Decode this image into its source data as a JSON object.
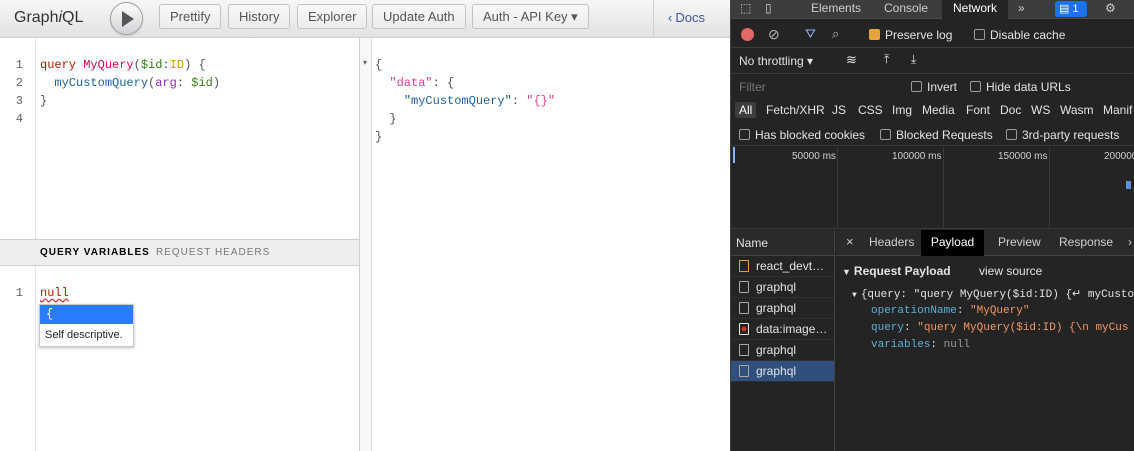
{
  "graphiql": {
    "logo_pre": "Graph",
    "logo_i": "i",
    "logo_post": "QL",
    "toolbar": {
      "prettify": "Prettify",
      "history": "History",
      "explorer": "Explorer",
      "update_auth": "Update Auth",
      "auth_select": "Auth - API Key ▾"
    },
    "docs_label": "Docs",
    "query_lines": [
      "1",
      "2",
      "3",
      "4"
    ],
    "query": {
      "l1_kw": "query",
      "l1_name": "MyQuery",
      "l1_open": "(",
      "l1_var": "$id",
      "l1_colon": ":",
      "l1_type": "ID",
      "l1_close": ") {",
      "l2_field": "myCustomQuery",
      "l2_open": "(",
      "l2_arg": "arg",
      "l2_colon": ": ",
      "l2_var": "$id",
      "l2_close": ")",
      "l3": "}"
    },
    "var_tabs": {
      "variables": "QUERY VARIABLES",
      "headers": "REQUEST HEADERS"
    },
    "var_line": "1",
    "var_value": "null",
    "hint": {
      "item": "{",
      "description": "Self descriptive."
    },
    "result": {
      "open": "{",
      "data_key": "\"data\"",
      "colon1": ": {",
      "field_key": "\"myCustomQuery\"",
      "colon2": ": ",
      "field_val": "\"{}\"",
      "inner_close": "}",
      "close": "}"
    }
  },
  "devtools": {
    "tabs": {
      "elements": "Elements",
      "console": "Console",
      "network": "Network",
      "more": "»",
      "badge": "1"
    },
    "toolbar1": {
      "preserve_log": "Preserve log",
      "disable_cache": "Disable cache"
    },
    "toolbar2": {
      "throttling": "No throttling",
      "dropdown": "▾"
    },
    "filter": {
      "placeholder": "Filter",
      "invert": "Invert",
      "hide_data_urls": "Hide data URLs"
    },
    "type_filters": [
      "All",
      "Fetch/XHR",
      "JS",
      "CSS",
      "Img",
      "Media",
      "Font",
      "Doc",
      "WS",
      "Wasm",
      "Manif"
    ],
    "block_filters": {
      "blocked_cookies": "Has blocked cookies",
      "blocked_requests": "Blocked Requests",
      "third_party": "3rd-party requests"
    },
    "timeline_ticks": [
      "50000 ms",
      "100000 ms",
      "150000 ms",
      "200000"
    ],
    "name_header": "Name",
    "requests": [
      "react_devt…",
      "graphql",
      "graphql",
      "data:image…",
      "graphql",
      "graphql"
    ],
    "selected_request_index": 5,
    "detail_tabs": {
      "close": "×",
      "headers": "Headers",
      "payload": "Payload",
      "preview": "Preview",
      "response": "Response",
      "more": "›"
    },
    "payload": {
      "section": "Request Payload",
      "view_source": "view source",
      "summary_key": "{query: ",
      "summary_val": "\"query MyQuery($id:ID) {↵ myCusto",
      "op_key": "operationName",
      "op_val": "\"MyQuery\"",
      "q_key": "query",
      "q_val": "\"query MyQuery($id:ID) {\\n  myCus",
      "vars_key": "variables",
      "vars_val": "null",
      "sep": ": "
    }
  }
}
